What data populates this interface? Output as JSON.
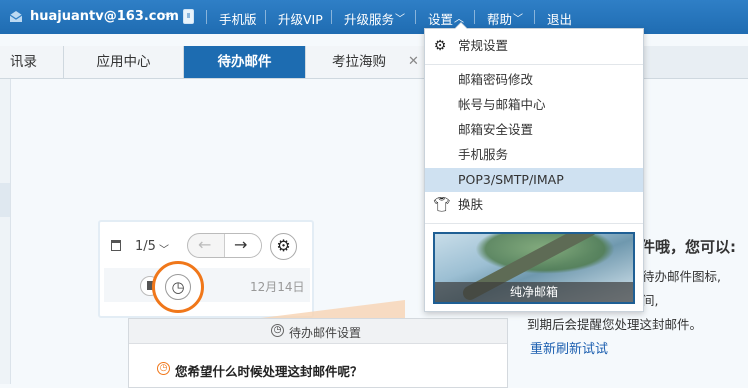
{
  "header": {
    "user": "huajuantv@163.com",
    "nav": [
      "手机版",
      "升级VIP",
      "升级服务",
      "设置",
      "帮助",
      "退出"
    ]
  },
  "tabs": [
    {
      "label": "讯录"
    },
    {
      "label": "应用中心"
    },
    {
      "label": "待办邮件",
      "active": true
    },
    {
      "label": "考拉海购"
    }
  ],
  "dropdown": {
    "items": [
      {
        "label": "常规设置",
        "icon": "gear-icon"
      },
      {
        "label": "邮箱密码修改"
      },
      {
        "label": "帐号与邮箱中心"
      },
      {
        "label": "邮箱安全设置"
      },
      {
        "label": "手机服务"
      },
      {
        "label": "POP3/SMTP/IMAP",
        "highlighted": true
      },
      {
        "label": "换肤",
        "icon": "tshirt-icon"
      }
    ],
    "skin_label": "纯净邮箱"
  },
  "illustration": {
    "page": "1/5",
    "date": "12月14日"
  },
  "panel": {
    "title": "待办邮件设置",
    "question": "您希望什么时候处理这封邮件呢？"
  },
  "content": {
    "headline": "件哦，您可以:",
    "lines": [
      "待办邮件图标,",
      "间,",
      "到期后会提醒您处理这封邮件。"
    ],
    "retry": "重新刷新试试"
  },
  "colors": {
    "topbar": "#1f6cb2",
    "active_tab": "#1d6cb1",
    "highlight": "#cfe1f1",
    "accent_orange": "#f0771a",
    "link": "#1c5fb0"
  }
}
